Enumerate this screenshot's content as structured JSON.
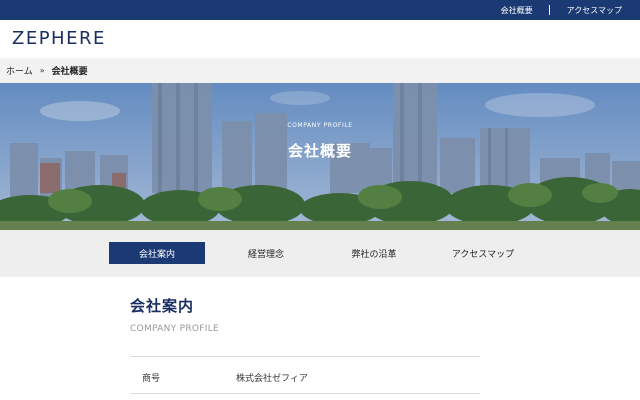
{
  "topbar": {
    "links": [
      "会社概要",
      "アクセスマップ"
    ]
  },
  "header": {
    "logo": "ZEPHERE"
  },
  "breadcrumb": {
    "home": "ホーム",
    "separator": "»",
    "current": "会社概要"
  },
  "hero": {
    "eyebrow": "COMPANY PROFILE",
    "title": "会社概要"
  },
  "subnav": {
    "tabs": [
      {
        "label": "会社案内",
        "active": true
      },
      {
        "label": "経営理念",
        "active": false
      },
      {
        "label": "弊社の沿革",
        "active": false
      },
      {
        "label": "アクセスマップ",
        "active": false
      }
    ]
  },
  "section": {
    "title": "会社案内",
    "subtitle": "COMPANY PROFILE",
    "rows": [
      {
        "label": "商号",
        "value": "株式会社ゼフィア"
      }
    ]
  },
  "colors": {
    "brand_navy": "#1b3a73",
    "logo_navy": "#1b2e63",
    "breadcrumb_bg": "#f2f2f2",
    "subnav_bg": "#eeeeee"
  }
}
